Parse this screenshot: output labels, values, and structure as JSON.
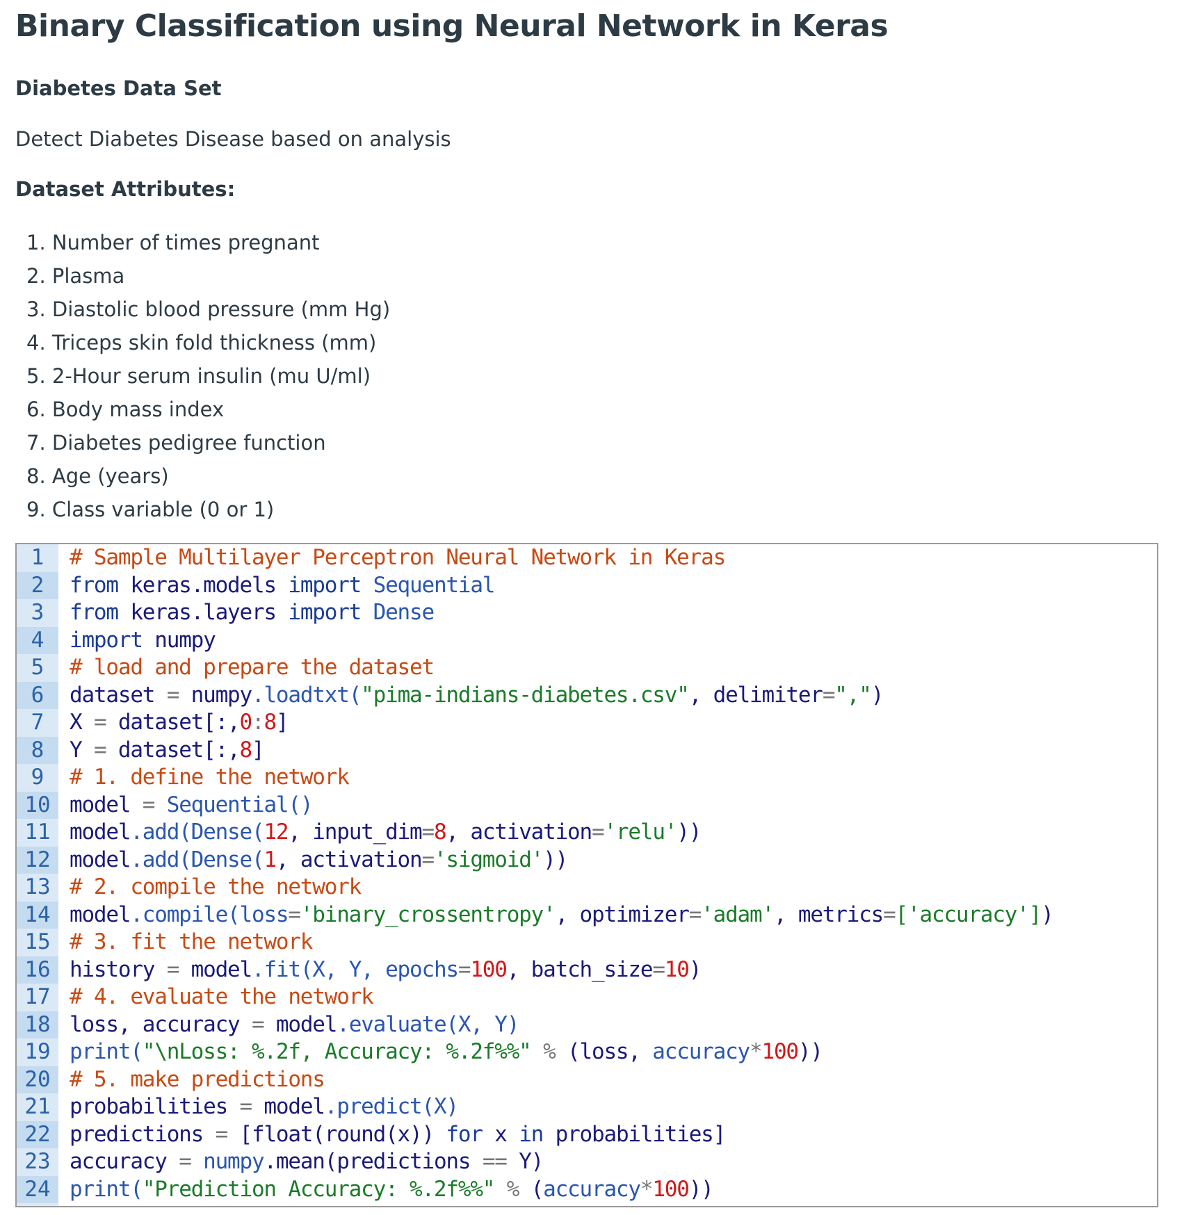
{
  "title": "Binary Classification using Neural Network in Keras",
  "subtitle": "Diabetes Data Set",
  "description": "Detect Diabetes Disease based on analysis",
  "attributes_heading": "Dataset Attributes:",
  "attributes": [
    "1. Number of times pregnant",
    "2. Plasma",
    "3. Diastolic blood pressure (mm Hg)",
    "4. Triceps skin fold thickness (mm)",
    "5. 2-Hour serum insulin (mu U/ml)",
    "6. Body mass index",
    "7. Diabetes pedigree function",
    "8. Age (years)",
    "9. Class variable (0 or 1)"
  ],
  "code": {
    "language": "python",
    "lines": [
      [
        [
          "# Sample Multilayer Perceptron Neural Network in Keras",
          "com"
        ]
      ],
      [
        [
          "from",
          "kw"
        ],
        [
          " keras.models ",
          "id"
        ],
        [
          "import",
          "kw"
        ],
        [
          " Sequential",
          "fn"
        ]
      ],
      [
        [
          "from",
          "kw"
        ],
        [
          " keras.layers ",
          "id"
        ],
        [
          "import",
          "kw"
        ],
        [
          " Dense",
          "fn"
        ]
      ],
      [
        [
          "import",
          "kw"
        ],
        [
          " numpy",
          "id"
        ]
      ],
      [
        [
          "# load and prepare the dataset",
          "com"
        ]
      ],
      [
        [
          "dataset ",
          "id"
        ],
        [
          "=",
          "op"
        ],
        [
          " numpy",
          "id"
        ],
        [
          ".loadtxt(",
          "fn"
        ],
        [
          "\"pima-indians-diabetes.csv\"",
          "str"
        ],
        [
          ", ",
          "id"
        ],
        [
          "delimiter",
          "id"
        ],
        [
          "=",
          "op"
        ],
        [
          "\",\"",
          "str"
        ],
        [
          ")",
          "id"
        ]
      ],
      [
        [
          "X ",
          "id"
        ],
        [
          "=",
          "op"
        ],
        [
          " dataset[:,",
          "id"
        ],
        [
          "0",
          "num"
        ],
        [
          ":",
          "op"
        ],
        [
          "8",
          "num"
        ],
        [
          "]",
          "id"
        ]
      ],
      [
        [
          "Y ",
          "id"
        ],
        [
          "=",
          "op"
        ],
        [
          " dataset[:,",
          "id"
        ],
        [
          "8",
          "num"
        ],
        [
          "]",
          "id"
        ]
      ],
      [
        [
          "# 1. define the network",
          "com"
        ]
      ],
      [
        [
          "model ",
          "id"
        ],
        [
          "=",
          "op"
        ],
        [
          " Sequential()",
          "fn"
        ]
      ],
      [
        [
          "model",
          "id"
        ],
        [
          ".add(Dense(",
          "fn"
        ],
        [
          "12",
          "num"
        ],
        [
          ", input_dim",
          "id"
        ],
        [
          "=",
          "op"
        ],
        [
          "8",
          "num"
        ],
        [
          ", activation",
          "id"
        ],
        [
          "=",
          "op"
        ],
        [
          "'relu'",
          "str"
        ],
        [
          "))",
          "id"
        ]
      ],
      [
        [
          "model",
          "id"
        ],
        [
          ".add(Dense(",
          "fn"
        ],
        [
          "1",
          "num"
        ],
        [
          ", activation",
          "id"
        ],
        [
          "=",
          "op"
        ],
        [
          "'sigmoid'",
          "str"
        ],
        [
          "))",
          "id"
        ]
      ],
      [
        [
          "# 2. compile the network",
          "com"
        ]
      ],
      [
        [
          "model",
          "id"
        ],
        [
          ".compile(loss",
          "fn"
        ],
        [
          "=",
          "op"
        ],
        [
          "'binary_crossentropy'",
          "str"
        ],
        [
          ", optimizer",
          "id"
        ],
        [
          "=",
          "op"
        ],
        [
          "'adam'",
          "str"
        ],
        [
          ", metrics",
          "id"
        ],
        [
          "=",
          "op"
        ],
        [
          "['accuracy']",
          "str"
        ],
        [
          ")",
          "id"
        ]
      ],
      [
        [
          "# 3. fit the network",
          "com"
        ]
      ],
      [
        [
          "history ",
          "id"
        ],
        [
          "=",
          "op"
        ],
        [
          " model",
          "id"
        ],
        [
          ".fit(X, Y, epochs",
          "fn"
        ],
        [
          "=",
          "op"
        ],
        [
          "100",
          "num"
        ],
        [
          ", batch_size",
          "id"
        ],
        [
          "=",
          "op"
        ],
        [
          "10",
          "num"
        ],
        [
          ")",
          "id"
        ]
      ],
      [
        [
          "# 4. evaluate the network",
          "com"
        ]
      ],
      [
        [
          "loss, accuracy ",
          "id"
        ],
        [
          "=",
          "op"
        ],
        [
          " model",
          "id"
        ],
        [
          ".evaluate(X, Y)",
          "fn"
        ]
      ],
      [
        [
          "print(",
          "fn"
        ],
        [
          "\"\\nLoss: %.2f, Accuracy: %.2f%%\"",
          "str"
        ],
        [
          " % ",
          "op"
        ],
        [
          "(loss, ",
          "id"
        ],
        [
          "accuracy",
          "fn"
        ],
        [
          "*",
          "op"
        ],
        [
          "100",
          "num"
        ],
        [
          "))",
          "id"
        ]
      ],
      [
        [
          "# 5. make predictions",
          "com"
        ]
      ],
      [
        [
          "probabilities ",
          "id"
        ],
        [
          "=",
          "op"
        ],
        [
          " model",
          "id"
        ],
        [
          ".predict(X)",
          "fn"
        ]
      ],
      [
        [
          "predictions ",
          "id"
        ],
        [
          "=",
          "op"
        ],
        [
          " [float(round(x)) ",
          "id"
        ],
        [
          "for",
          "kw"
        ],
        [
          " x ",
          "id"
        ],
        [
          "in",
          "kw"
        ],
        [
          " probabilities]",
          "id"
        ]
      ],
      [
        [
          "accuracy ",
          "id"
        ],
        [
          "=",
          "op"
        ],
        [
          " numpy",
          "fn"
        ],
        [
          ".mean(predictions ",
          "id"
        ],
        [
          "==",
          "op"
        ],
        [
          " Y)",
          "id"
        ]
      ],
      [
        [
          "print(",
          "fn"
        ],
        [
          "\"Prediction Accuracy: %.2f%%\"",
          "str"
        ],
        [
          " % ",
          "op"
        ],
        [
          "(",
          "id"
        ],
        [
          "accuracy",
          "fn"
        ],
        [
          "*",
          "op"
        ],
        [
          "100",
          "num"
        ],
        [
          "))",
          "id"
        ]
      ]
    ]
  }
}
